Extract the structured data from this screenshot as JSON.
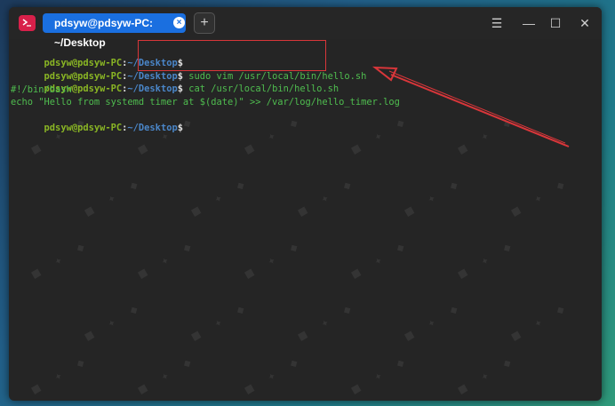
{
  "window": {
    "tab_title": "pdsyw@pdsyw-PC: ~/Desktop",
    "tab_close_glyph": "×",
    "new_tab_glyph": "+",
    "menu_glyph": "☰",
    "minimize_glyph": "—",
    "maximize_glyph": "☐",
    "close_glyph": "✕",
    "app_icon": "terminal-icon",
    "accent_color": "#1a6fe0",
    "icon_color": "#d8204a"
  },
  "terminal": {
    "lines": [
      {
        "user": "pdsyw@pdsyw-PC",
        "path": "~/Desktop",
        "dollar": "$",
        "cmd": ""
      },
      {
        "user": "pdsyw@pdsyw-PC",
        "path": "~/Desktop",
        "dollar": "$",
        "cmd": "sudo vim /usr/local/bin/hello.sh"
      },
      {
        "user": "pdsyw@pdsyw-PC",
        "path": "~/Desktop",
        "dollar": "$",
        "cmd": "cat /usr/local/bin/hello.sh"
      },
      {
        "text": "#!/bin/bash"
      },
      {
        "text": "echo \"Hello from systemd timer at $(date)\" >> /var/log/hello_timer.log"
      },
      {
        "user": "pdsyw@pdsyw-PC",
        "path": "~/Desktop",
        "dollar": "$",
        "cmd": ""
      }
    ],
    "prompt_colon": ":"
  },
  "annotation": {
    "highlight_color": "#d9363a"
  }
}
